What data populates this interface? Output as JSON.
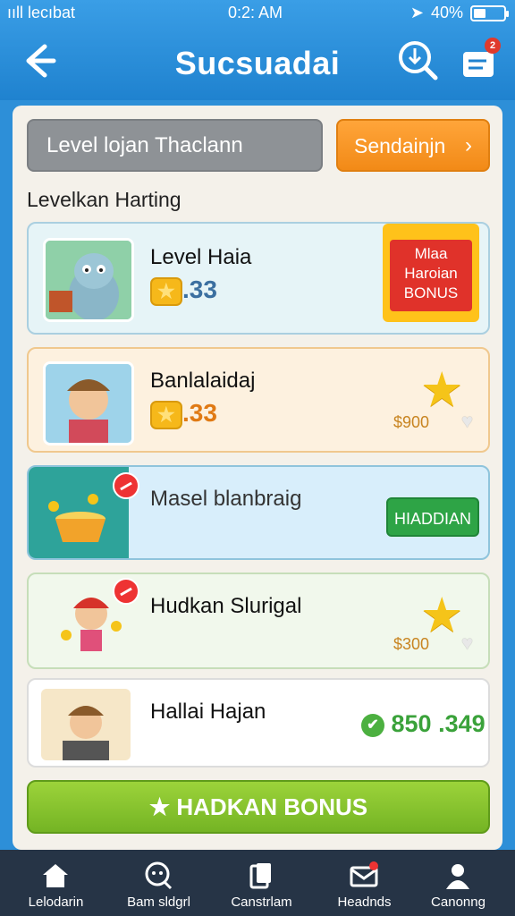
{
  "status": {
    "carrier": "ııll lecıbat",
    "time": "0:2: AM",
    "battery": "40%",
    "battery_level": 0.4
  },
  "header": {
    "title": "Sucsuadai",
    "notification_count": "2"
  },
  "top": {
    "level_field": "Level lojan Thaclann",
    "send_button": "Sendainjn"
  },
  "section": {
    "label": "Levelkan Harting"
  },
  "items": [
    {
      "name": "Level Haia",
      "amount": ".33",
      "tag_lines": [
        "Mlaa",
        "Haroian",
        "BONUS"
      ]
    },
    {
      "name": "Banlalaidaj",
      "amount": ".33",
      "price": "$900"
    },
    {
      "name": "Masel blanbraig",
      "button": "HIADDIAN"
    },
    {
      "name": "Hudkan Slurigal",
      "price": "$300"
    },
    {
      "name": "Hallai Hajan",
      "amount": "850 .349"
    }
  ],
  "bonus_button": "HADKAN BONUS",
  "tabs": [
    {
      "label": "Lelodarin",
      "icon": "home-icon"
    },
    {
      "label": "Bam sldgrl",
      "icon": "chat-icon"
    },
    {
      "label": "Canstrlam",
      "icon": "cards-icon"
    },
    {
      "label": "Headnds",
      "icon": "mail-icon"
    },
    {
      "label": "Canonng",
      "icon": "profile-icon"
    }
  ],
  "colors": {
    "brand": "#2d8fd8",
    "accent": "#f28a17",
    "success": "#2ea446",
    "bonus": "#7fbf28"
  }
}
